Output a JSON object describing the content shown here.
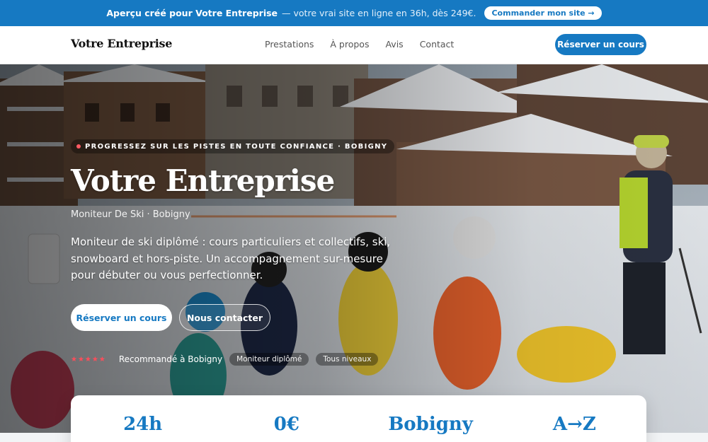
{
  "banner": {
    "lead": "Aperçu créé pour Votre Entreprise",
    "text": "— votre vrai site en ligne en 36h, dès 249€.",
    "cta": "Commander mon site →"
  },
  "header": {
    "brand": "Votre Entreprise",
    "nav": [
      "Prestations",
      "À propos",
      "Avis",
      "Contact"
    ],
    "cta": "Réserver un cours"
  },
  "hero": {
    "eyebrow": "PROGRESSEZ SUR LES PISTES EN TOUTE CONFIANCE · BOBIGNY",
    "title": "Votre Entreprise",
    "subtitle": "Moniteur De Ski · Bobigny",
    "description": "Moniteur de ski diplômé : cours particuliers et collectifs, ski, snowboard et hors-piste. Un accompagnement sur-mesure pour débuter ou vous perfectionner.",
    "primary_cta": "Réserver un cours",
    "secondary_cta": "Nous contacter",
    "stars": "★★★★★",
    "trust_text": "Recommandé à Bobigny",
    "badges": [
      "Moniteur diplômé",
      "Tous niveaux"
    ]
  },
  "stats": [
    "24h",
    "0€",
    "Bobigny",
    "A→Z"
  ],
  "colors": {
    "accent": "#1679c2",
    "star": "#ff4d5a",
    "banner": "#1679c2"
  },
  "icons": {
    "eyebrow_dot": "dot-icon",
    "stars": "star-icon"
  }
}
